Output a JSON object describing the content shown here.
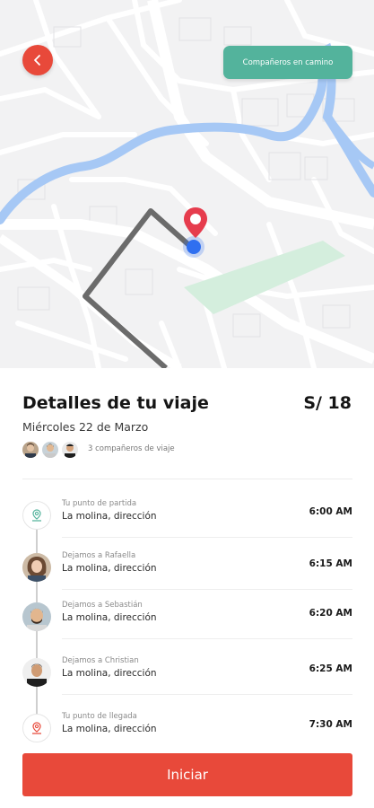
{
  "map": {
    "back_icon": "chevron-left-icon",
    "companions_button": "Compañeros en camino",
    "pin_icon": "map-pin-icon",
    "colors": {
      "water": "#a6c8f5",
      "park": "#d4eedd",
      "route": "#6b6b6b",
      "pin": "#e63c4d",
      "location": "#2f6ff0"
    }
  },
  "trip": {
    "title": "Detalles de tu viaje",
    "price": "S/ 18",
    "date": "Miércoles 22 de Marzo",
    "companions_text": "3 compañeros de viaje"
  },
  "stops": [
    {
      "label": "Tu punto de partida",
      "address": "La molina, dirección",
      "time": "6:00 AM",
      "icon": "start-location-icon"
    },
    {
      "label": "Dejamos a Rafaella",
      "address": "La molina, dirección",
      "time": "6:15 AM",
      "icon": "avatar-rafaella"
    },
    {
      "label": "Dejamos a Sebastián",
      "address": "La molina, dirección",
      "time": "6:20 AM",
      "icon": "avatar-sebastian"
    },
    {
      "label": "Dejamos a Christian",
      "address": "La molina, dirección",
      "time": "6:25 AM",
      "icon": "avatar-christian"
    },
    {
      "label": "Tu punto de llegada",
      "address": "La molina, dirección",
      "time": "7:30 AM",
      "icon": "end-location-icon"
    }
  ],
  "actions": {
    "start_button": "Iniciar"
  },
  "colors": {
    "accent": "#e8493a",
    "teal": "#53b39c"
  }
}
